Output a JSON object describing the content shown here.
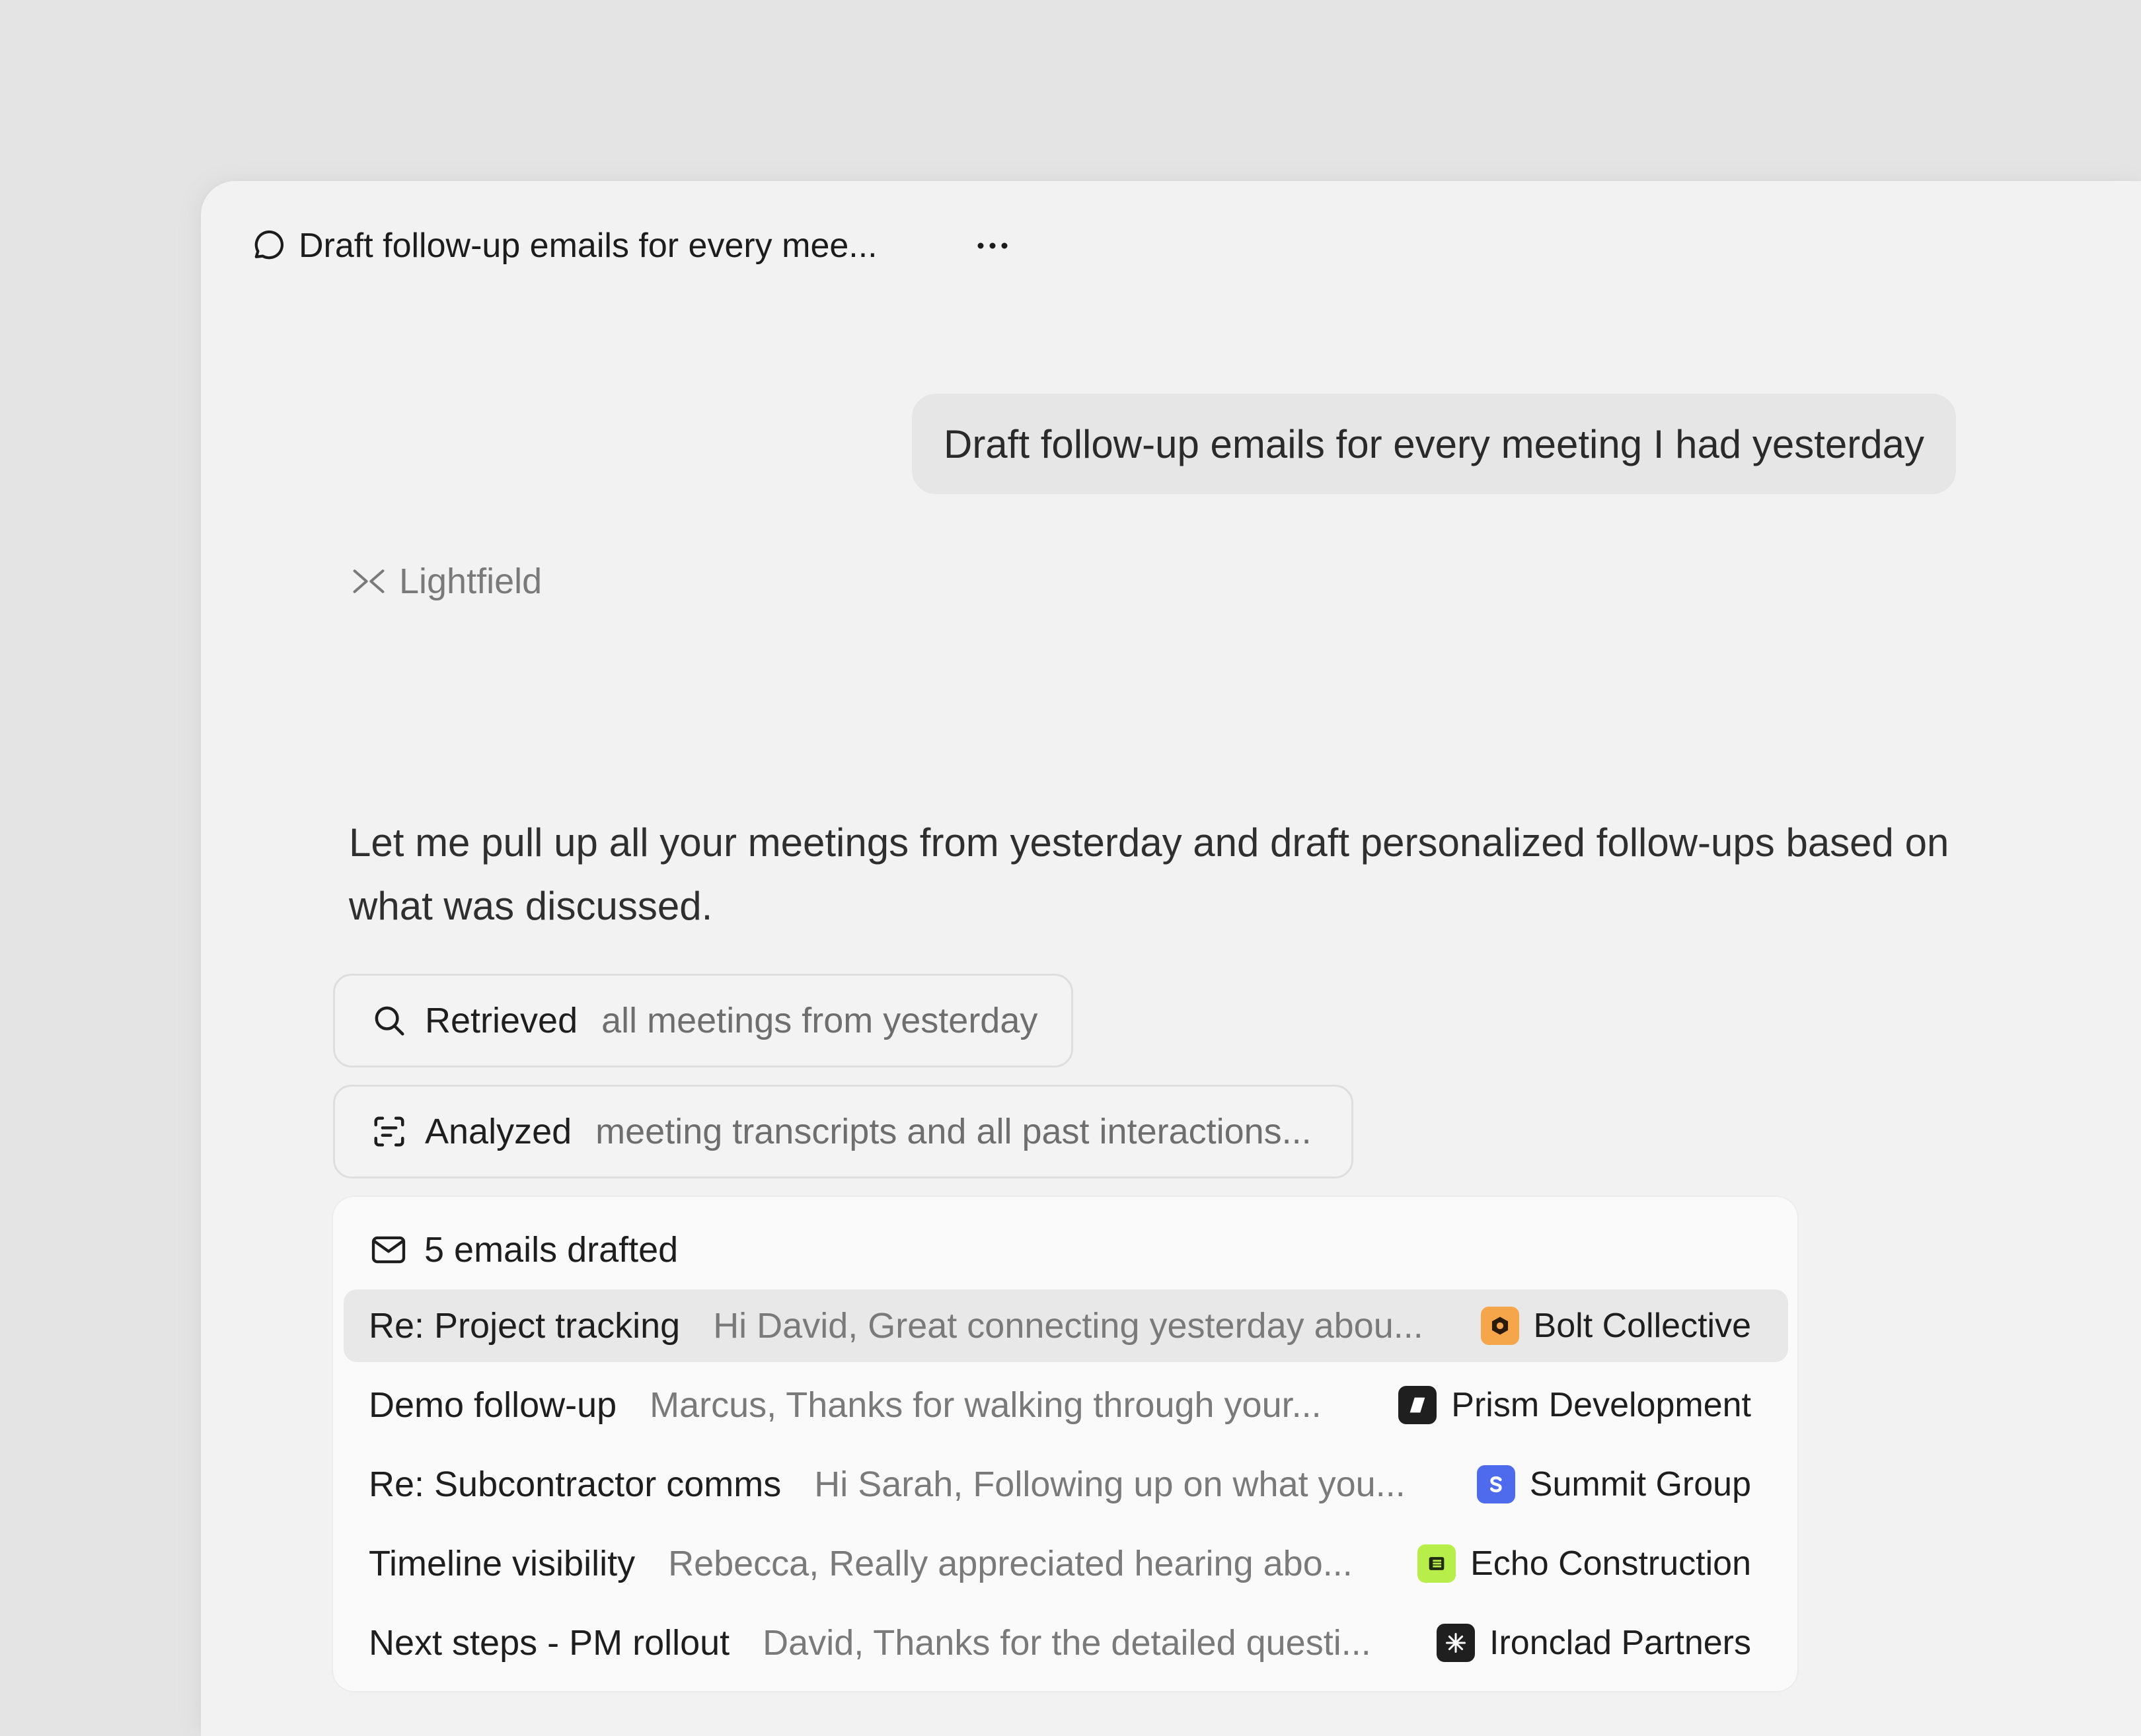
{
  "window": {
    "title": "Draft follow-up emails for every mee...",
    "title_icon": "chat-bubble-icon",
    "more_icon": "more-horizontal-icon"
  },
  "user_message": "Draft follow-up emails for every meeting I had yesterday",
  "assistant": {
    "name": "Lightfield",
    "logo_icon": "lightfield-logo-icon",
    "message": "Let me pull up all your meetings from yesterday and draft personalized follow-ups based on what was discussed."
  },
  "steps": [
    {
      "verb": "Retrieved",
      "detail": "all meetings from yesterday",
      "icon": "search-icon"
    },
    {
      "verb": "Analyzed",
      "detail": "meeting transcripts and all past interactions...",
      "icon": "scan-text-icon"
    }
  ],
  "emails": {
    "header": "5 emails drafted",
    "header_icon": "mail-icon",
    "items": [
      {
        "subject": "Re: Project tracking",
        "preview": "Hi David, Great connecting yesterday abou...",
        "company": "Bolt Collective",
        "badge_color": "#f5a54a",
        "badge_icon": "hexagon-logo-icon",
        "highlighted": true
      },
      {
        "subject": "Demo follow-up",
        "preview": "Marcus, Thanks for walking through your...",
        "company": "Prism Development",
        "badge_color": "#1f1f1f",
        "badge_icon": "parallelogram-logo-icon",
        "highlighted": false
      },
      {
        "subject": "Re: Subcontractor comms",
        "preview": "Hi Sarah, Following up on what you...",
        "company": "Summit Group",
        "badge_color": "#4f6bed",
        "badge_icon": "letter-s-logo-icon",
        "highlighted": false
      },
      {
        "subject": "Timeline visibility",
        "preview": "Rebecca, Really appreciated hearing abo...",
        "company": "Echo Construction",
        "badge_color": "#b7ee4a",
        "badge_icon": "bars-logo-icon",
        "highlighted": false
      },
      {
        "subject": "Next steps - PM rollout",
        "preview": "David, Thanks for the detailed questi...",
        "company": "Ironclad Partners",
        "badge_color": "#1f1f1f",
        "badge_icon": "asterisk-logo-icon",
        "highlighted": false
      }
    ]
  }
}
